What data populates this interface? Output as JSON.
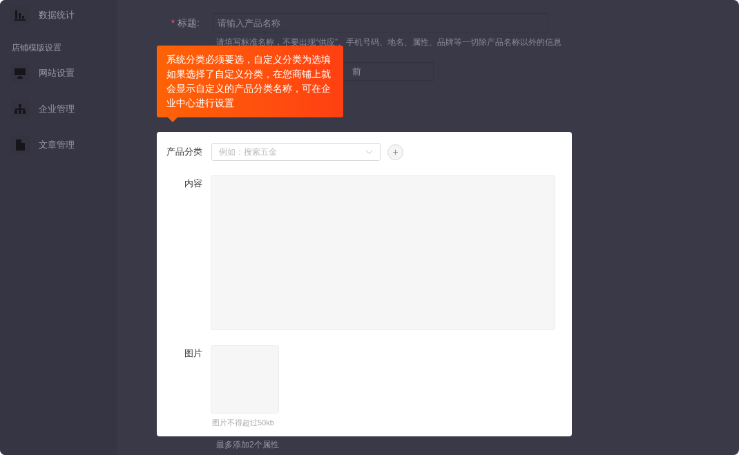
{
  "sidebar": {
    "items": [
      {
        "label": "数据统计"
      }
    ],
    "section_title": "店铺模版设置",
    "section_items": [
      {
        "label": "网站设置"
      },
      {
        "label": "企业管理"
      },
      {
        "label": "文章管理"
      }
    ]
  },
  "form": {
    "title_field": {
      "label": "标题:",
      "required": true,
      "required_mark": "*",
      "placeholder": "请输入产品名称",
      "hint": "请填写标准名称，不要出现“供应”、手机号码、地名、属性、品牌等一切除产品名称以外的信息"
    },
    "second_field": {
      "value": "前"
    },
    "footer_note": "最多添加2个属性"
  },
  "tooltip": {
    "text": "系统分类必须要选，自定义分类为选填如果选择了自定义分类，在您商铺上就会显示自定义的产品分类名称，可在企业中心进行设置"
  },
  "dialog": {
    "category": {
      "label": "产品分类",
      "placeholder": "例如：搜索五金",
      "add_button": "+"
    },
    "content": {
      "label": "内容"
    },
    "image": {
      "label": "图片",
      "hint": "图片不得超过50kb"
    }
  }
}
